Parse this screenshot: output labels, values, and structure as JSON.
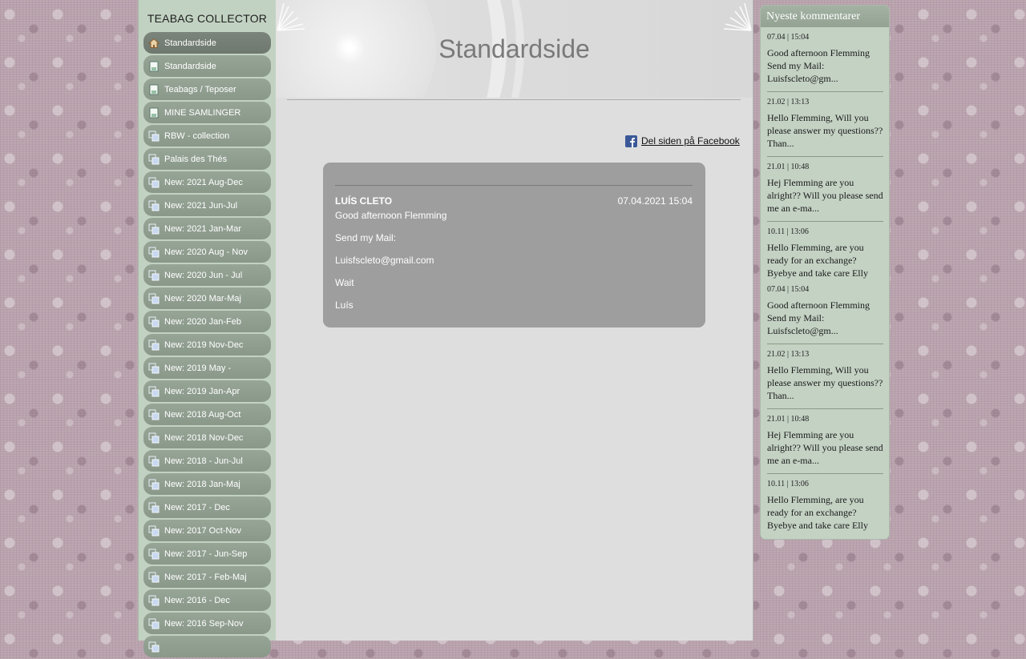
{
  "site": {
    "title": "TEABAG COLLECTOR"
  },
  "nav": {
    "items": [
      {
        "label": "Standardside",
        "icon": "home-icon",
        "active": true
      },
      {
        "label": "Standardside",
        "icon": "page-icon"
      },
      {
        "label": "Teabags / Teposer",
        "icon": "page-icon"
      },
      {
        "label": "MINE SAMLINGER",
        "icon": "page-icon"
      },
      {
        "label": "RBW - collection",
        "icon": "gallery-icon"
      },
      {
        "label": "Palais des Thés",
        "icon": "gallery-icon"
      },
      {
        "label": "New: 2021 Aug-Dec",
        "icon": "gallery-icon"
      },
      {
        "label": "New: 2021 Jun-Jul",
        "icon": "gallery-icon"
      },
      {
        "label": "New: 2021 Jan-Mar",
        "icon": "gallery-icon"
      },
      {
        "label": "New: 2020 Aug - Nov",
        "icon": "gallery-icon"
      },
      {
        "label": "New: 2020 Jun - Jul",
        "icon": "gallery-icon"
      },
      {
        "label": "New: 2020 Mar-Maj",
        "icon": "gallery-icon"
      },
      {
        "label": "New: 2020 Jan-Feb",
        "icon": "gallery-icon"
      },
      {
        "label": "New: 2019 Nov-Dec",
        "icon": "gallery-icon"
      },
      {
        "label": "New: 2019 May -",
        "icon": "gallery-icon"
      },
      {
        "label": "New: 2019 Jan-Apr",
        "icon": "gallery-icon"
      },
      {
        "label": "New: 2018 Aug-Oct",
        "icon": "gallery-icon"
      },
      {
        "label": "New: 2018 Nov-Dec",
        "icon": "gallery-icon"
      },
      {
        "label": "New: 2018 - Jun-Jul",
        "icon": "gallery-icon"
      },
      {
        "label": "New: 2018 Jan-Maj",
        "icon": "gallery-icon"
      },
      {
        "label": "New: 2017 - Dec",
        "icon": "gallery-icon"
      },
      {
        "label": "New: 2017 Oct-Nov",
        "icon": "gallery-icon"
      },
      {
        "label": "New: 2017 - Jun-Sep",
        "icon": "gallery-icon"
      },
      {
        "label": "New: 2017 - Feb-Maj",
        "icon": "gallery-icon"
      },
      {
        "label": "New: 2016 - Dec",
        "icon": "gallery-icon"
      },
      {
        "label": "New: 2016 Sep-Nov",
        "icon": "gallery-icon"
      },
      {
        "label": "",
        "icon": "gallery-icon"
      }
    ]
  },
  "main": {
    "page_title": "Standardside",
    "share_label": "Del siden på Facebook",
    "comment": {
      "author": "LUÍS CLETO",
      "date": "07.04.2021 15:04",
      "lines": [
        "Good afternoon Flemming",
        "Send my Mail:",
        "Luisfscleto@gmail.com",
        "Wait",
        "Luís"
      ]
    }
  },
  "sidebar": {
    "title": "Nyeste kommentarer",
    "comments": [
      {
        "date": "07.04 | 15:04",
        "text": "Good afternoon Flemming Send my Mail: Luisfscleto@gm..."
      },
      {
        "date": "21.02 | 13:13",
        "text": "Hello Flemming, Will you please answer my questions?? Than..."
      },
      {
        "date": "21.01 | 10:48",
        "text": "Hej Flemming are you alright?? Will you please send me an e-ma..."
      },
      {
        "date": "10.11 | 13:06",
        "text": "Hello Flemming, are you ready for an exchange? Byebye and take care Elly"
      },
      {
        "date": "07.04 | 15:04",
        "text": "Good afternoon Flemming Send my Mail: Luisfscleto@gm..."
      },
      {
        "date": "21.02 | 13:13",
        "text": "Hello Flemming, Will you please answer my questions?? Than..."
      },
      {
        "date": "21.01 | 10:48",
        "text": "Hej Flemming are you alright?? Will you please send me an e-ma..."
      },
      {
        "date": "10.11 | 13:06",
        "text": "Hello Flemming, are you ready for an exchange? Byebye and take care Elly"
      }
    ]
  },
  "colors": {
    "nav_item": "#8a988a",
    "nav_active": "#6e786e",
    "card": "#9e9e9e",
    "sidebar_bg": "#c4d2c4"
  }
}
